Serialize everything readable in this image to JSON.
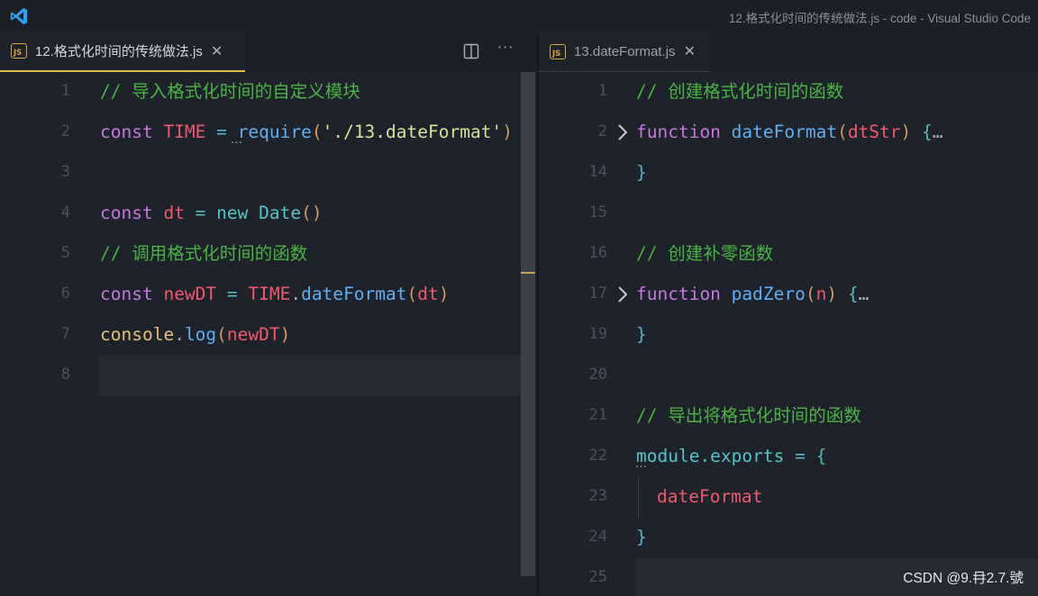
{
  "window": {
    "title": "12.格式化时间的传统做法.js - code - Visual Studio Code",
    "accent": "#e5b64b"
  },
  "left_pane": {
    "tab": {
      "label": "12.格式化时间的传统做法.js",
      "icon": "js-file-icon",
      "active": true
    },
    "lines": [
      {
        "n": "1",
        "comment": "// 导入格式化时间的自定义模块"
      },
      {
        "n": "2",
        "kw": "const",
        "var": "TIME",
        "op": " = ",
        "fn": "require",
        "p1": "(",
        "str": "'./13.dateFormat'",
        "p2": ")"
      },
      {
        "n": "3"
      },
      {
        "n": "4",
        "kw": "const",
        "var": "dt",
        "op": " = ",
        "kw2": "new",
        "cls": "Date",
        "p": "()"
      },
      {
        "n": "5",
        "comment": "// 调用格式化时间的函数"
      },
      {
        "n": "6",
        "kw": "const",
        "var": "newDT",
        "op": " = ",
        "var2": "TIME",
        "dot": ".",
        "fn": "dateFormat",
        "p1": "(",
        "arg": "dt",
        "p2": ")"
      },
      {
        "n": "7",
        "obj": "console",
        "dot": ".",
        "fn": "log",
        "p1": "(",
        "arg": "newDT",
        "p2": ")"
      },
      {
        "n": "8"
      }
    ]
  },
  "right_pane": {
    "tab": {
      "label": "13.dateFormat.js",
      "icon": "js-file-icon",
      "active": false
    },
    "lines": [
      {
        "n": "1",
        "comment": "// 创建格式化时间的函数"
      },
      {
        "n": "2",
        "kw": "function",
        "fn": "dateFormat",
        "p1": "(",
        "param": "dtStr",
        "p2": ")",
        "brace": "{",
        "fold": "…"
      },
      {
        "n": "14",
        "brace": "}"
      },
      {
        "n": "15"
      },
      {
        "n": "16",
        "comment": "// 创建补零函数"
      },
      {
        "n": "17",
        "kw": "function",
        "fn": "padZero",
        "p1": "(",
        "param": "n",
        "p2": ")",
        "brace": "{",
        "fold": "…"
      },
      {
        "n": "19",
        "brace": "}"
      },
      {
        "n": "20"
      },
      {
        "n": "21",
        "comment": "// 导出将格式化时间的函数"
      },
      {
        "n": "22",
        "obj": "module.exports",
        "op": " = ",
        "brace": "{"
      },
      {
        "n": "23",
        "prop": "dateFormat"
      },
      {
        "n": "24",
        "brace": "}"
      },
      {
        "n": "25"
      }
    ]
  },
  "hints": {
    "ellipsis": "…",
    "more": "···"
  },
  "watermark": "CSDN @9.冄2.7.號"
}
